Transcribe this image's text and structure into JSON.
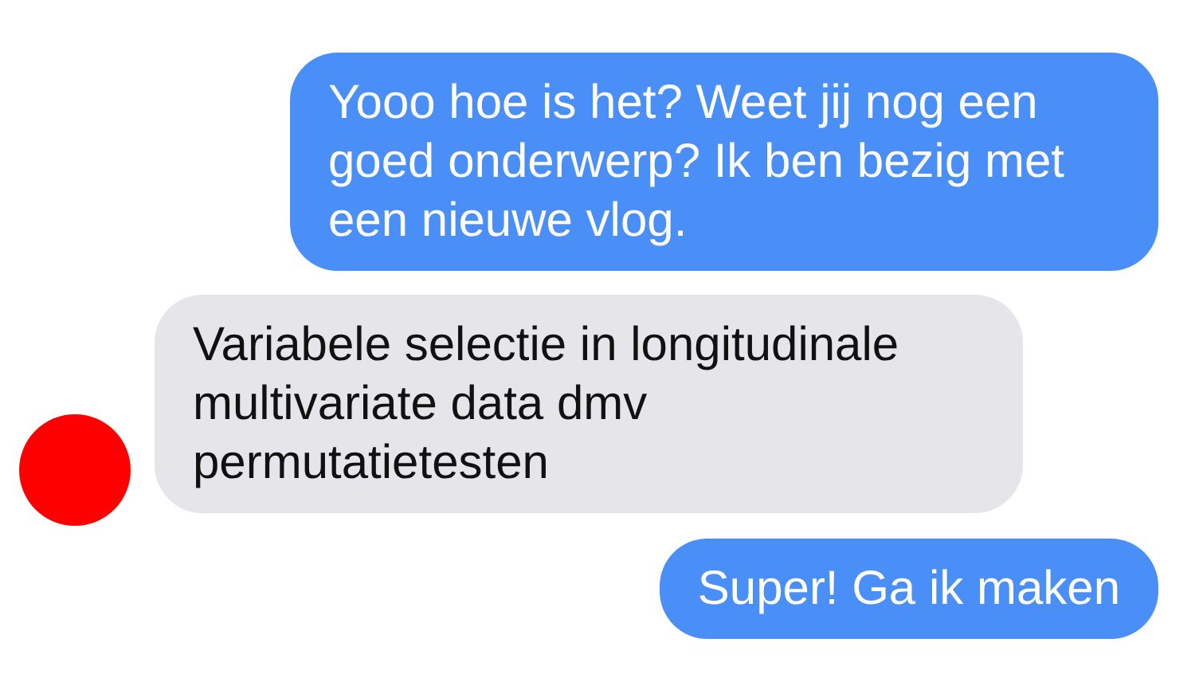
{
  "messages": [
    {
      "kind": "sent",
      "text": "Yooo hoe is het? Weet jij nog een goed onderwerp? Ik ben bezig met een nieuwe vlog."
    },
    {
      "kind": "received",
      "text": "Variabele selectie in longitudinale multivariate data dmv permutatietesten",
      "avatar": true
    },
    {
      "kind": "sent",
      "text": "Super! Ga ik maken"
    }
  ]
}
